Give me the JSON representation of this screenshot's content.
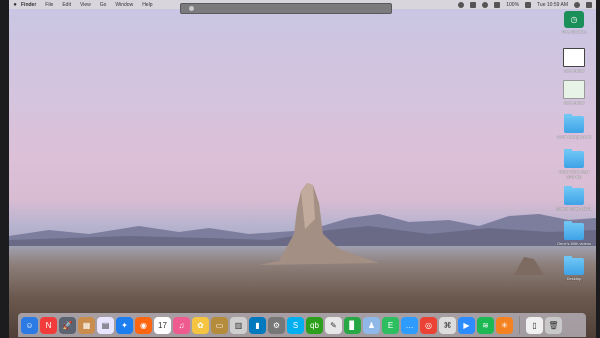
{
  "menubar": {
    "apple": "",
    "items": [
      "Finder",
      "File",
      "Edit",
      "View",
      "Go",
      "Window",
      "Help"
    ],
    "battery": "100%",
    "clock": "Tue 10:59 AM"
  },
  "desktop_icons": [
    {
      "label": "Time Machine",
      "kind": "time-machine"
    },
    {
      "label": "Screenshot",
      "kind": "document"
    },
    {
      "label": "Screenshot",
      "kind": "document-green"
    },
    {
      "label": "Zoom backgrounds",
      "kind": "folder"
    },
    {
      "label": "Walla Walla Sept 2020 trip",
      "kind": "folder"
    },
    {
      "label": "Sharon Shaw MKAL",
      "kind": "folder"
    },
    {
      "label": "Gene's 80th videos",
      "kind": "folder"
    },
    {
      "label": "Desktop",
      "kind": "folder"
    }
  ],
  "dock": {
    "apps": [
      {
        "name": "Finder",
        "icon": "☺",
        "color": "#2c7be5"
      },
      {
        "name": "News",
        "icon": "N",
        "color": "#f23c3c"
      },
      {
        "name": "Launchpad",
        "icon": "🚀",
        "color": "#5b6470"
      },
      {
        "name": "Preview",
        "icon": "▦",
        "color": "#c98d4d"
      },
      {
        "name": "Calendar",
        "icon": "▤",
        "color": "#e9e5ff"
      },
      {
        "name": "Safari",
        "icon": "✦",
        "color": "#1d7ef0"
      },
      {
        "name": "Firefox",
        "icon": "◉",
        "color": "#ff6611"
      },
      {
        "name": "Calendar",
        "icon": "17",
        "color": "#ffffff"
      },
      {
        "name": "Music",
        "icon": "♫",
        "color": "#f05b8f"
      },
      {
        "name": "Photos",
        "icon": "✿",
        "color": "#f5c542"
      },
      {
        "name": "Notes",
        "icon": "▭",
        "color": "#b58b3c"
      },
      {
        "name": "Preview",
        "icon": "▥",
        "color": "#cfcfcf"
      },
      {
        "name": "Trello",
        "icon": "▮",
        "color": "#0079bf"
      },
      {
        "name": "System Preferences",
        "icon": "⚙",
        "color": "#777777"
      },
      {
        "name": "Skype",
        "icon": "S",
        "color": "#00aff0"
      },
      {
        "name": "QuickBooks",
        "icon": "qb",
        "color": "#2ca01c"
      },
      {
        "name": "TextEdit",
        "icon": "✎",
        "color": "#e7e7e7"
      },
      {
        "name": "Numbers",
        "icon": "▊",
        "color": "#28a745"
      },
      {
        "name": "Family",
        "icon": "♟",
        "color": "#8fb8e8"
      },
      {
        "name": "Evernote",
        "icon": "E",
        "color": "#2dbe60"
      },
      {
        "name": "Messages",
        "icon": "…",
        "color": "#2e9bff"
      },
      {
        "name": "Chrome",
        "icon": "◎",
        "color": "#ea4335"
      },
      {
        "name": "Screenshot",
        "icon": "⌘",
        "color": "#dddddd"
      },
      {
        "name": "Zoom",
        "icon": "▶",
        "color": "#2d8cff"
      },
      {
        "name": "Spotify",
        "icon": "≋",
        "color": "#1db954"
      },
      {
        "name": "Starburst",
        "icon": "✳",
        "color": "#f58220"
      }
    ],
    "calendar_badge": "",
    "right": [
      {
        "name": "Document",
        "icon": "▯",
        "color": "#f0f0f0"
      },
      {
        "name": "Trash",
        "icon": "🗑",
        "color": "#c8c8c8"
      }
    ]
  }
}
